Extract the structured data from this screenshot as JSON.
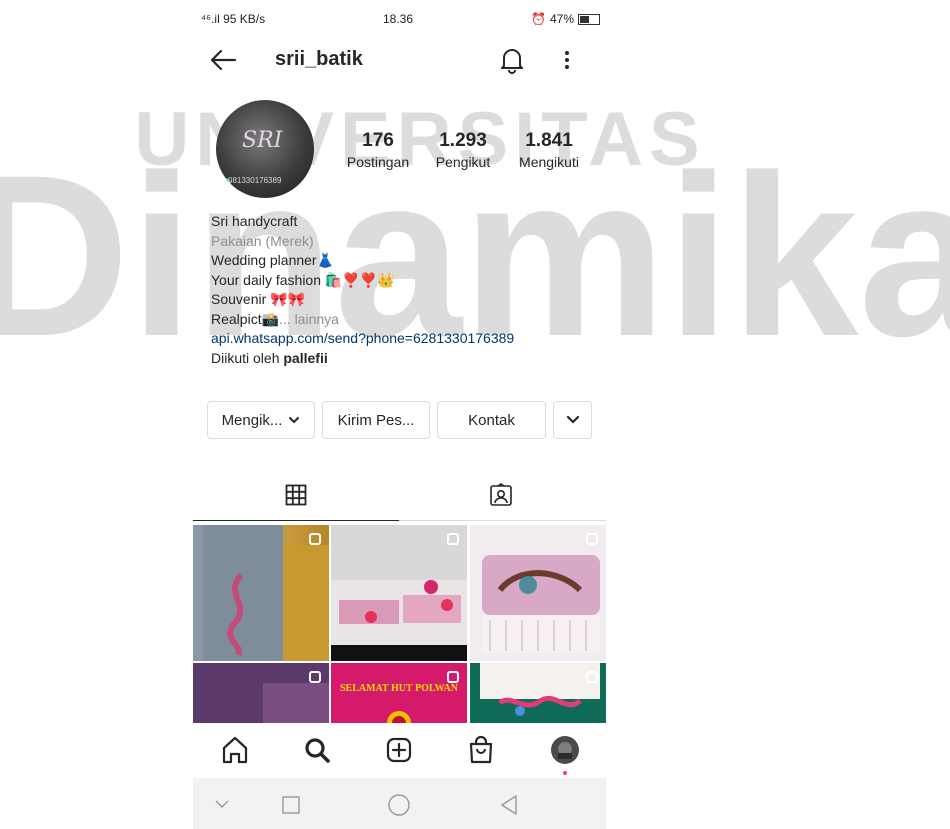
{
  "watermark": {
    "line1": "UNIVERSITAS",
    "line2": "Dinamika"
  },
  "status_bar": {
    "signal": "⁴⁶.il 95 KB/s",
    "time": "18.36",
    "battery": "47%"
  },
  "header": {
    "username": "srii_batik"
  },
  "avatar": {
    "logo": "SRI",
    "phone": "081330176389"
  },
  "stats": [
    {
      "value": "176",
      "label": "Postingan"
    },
    {
      "value": "1.293",
      "label": "Pengikut"
    },
    {
      "value": "1.841",
      "label": "Mengikuti"
    }
  ],
  "bio": {
    "name": "Sri handycraft",
    "category": "Pakaian (Merek)",
    "line1": "Wedding planner👗",
    "line2": "Your daily fashion 🛍️❣️❣️👑",
    "line3": "Souvenir 🎀🎀",
    "line4": "Realpict📸",
    "more": "... lainnya",
    "link": "api.whatsapp.com/send?phone=6281330176389",
    "followed_prefix": "Diikuti oleh ",
    "followed_by": "pallefii"
  },
  "buttons": {
    "following": "Mengik...",
    "message": "Kirim Pes...",
    "contact": "Kontak"
  },
  "grid_posts": [
    {
      "title": "",
      "colors": [
        "#8b98a7",
        "#c89a3b"
      ]
    },
    {
      "title": "",
      "colors": [
        "#2a2a2a",
        "#e8b9cf"
      ]
    },
    {
      "title": "",
      "colors": [
        "#d8b7c8",
        "#efe4e9"
      ]
    },
    {
      "title": "",
      "colors": [
        "#5a3a6a",
        "#8a5a7a"
      ]
    },
    {
      "title": "SELAMAT HUT POLWAN",
      "colors": [
        "#d51a6c",
        "#b4004f"
      ]
    },
    {
      "title": "",
      "colors": [
        "#f3f3f3",
        "#0e6d58"
      ]
    }
  ],
  "colors": {
    "accent_link": "#00376b",
    "muted": "#8e8e8e",
    "notif_dot": "#ed4956"
  }
}
